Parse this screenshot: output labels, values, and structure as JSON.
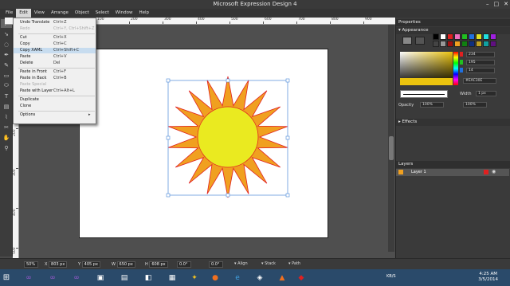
{
  "window": {
    "title": "Microsoft Expression Design 4"
  },
  "menubar": [
    "File",
    "Edit",
    "View",
    "Arrange",
    "Object",
    "Select",
    "Window",
    "Help"
  ],
  "edit_menu": [
    {
      "label": "Undo Translate",
      "shortcut": "Ctrl+Z",
      "disabled": false
    },
    {
      "label": "Redo",
      "shortcut": "Ctrl+Y, Ctrl+Shift+Z",
      "disabled": true
    },
    {
      "label": "Cut",
      "shortcut": "Ctrl+X",
      "disabled": false
    },
    {
      "label": "Copy",
      "shortcut": "Ctrl+C",
      "disabled": false
    },
    {
      "label": "Copy XAML",
      "shortcut": "Ctrl+Shift+C",
      "disabled": false,
      "highlighted": true
    },
    {
      "label": "Paste",
      "shortcut": "Ctrl+V",
      "disabled": false
    },
    {
      "label": "Delete",
      "shortcut": "Del",
      "disabled": false
    },
    {
      "label": "Paste in Front",
      "shortcut": "Ctrl+F",
      "disabled": false
    },
    {
      "label": "Paste in Back",
      "shortcut": "Ctrl+B",
      "disabled": false
    },
    {
      "label": "Paste Special",
      "shortcut": "",
      "disabled": true
    },
    {
      "label": "Paste with Layer",
      "shortcut": "Ctrl+Alt+L",
      "disabled": false
    },
    {
      "label": "Duplicate",
      "shortcut": "",
      "disabled": false
    },
    {
      "label": "Clone",
      "shortcut": "",
      "disabled": false
    },
    {
      "label": "Options",
      "shortcut": "",
      "disabled": false
    }
  ],
  "ruler": {
    "h_labels": [
      "-100",
      "0",
      "100",
      "200",
      "300",
      "400",
      "500",
      "600",
      "700",
      "800",
      "900",
      "1000"
    ],
    "v_labels": [
      "0",
      "100",
      "200",
      "300",
      "400",
      "500"
    ]
  },
  "bottombar": {
    "zoom": "50%",
    "x_label": "X",
    "x_value": "803 px",
    "y_label": "Y",
    "y_value": "405 px",
    "w_label": "W",
    "w_value": "650 px",
    "h_label": "H",
    "h_value": "608 px",
    "rot_value": "0.0°",
    "skew_value": "0.0°",
    "align": "Align",
    "stack": "Stack",
    "path": "Path"
  },
  "properties": {
    "title": "Properties",
    "appearance": "Appearance",
    "r": "234",
    "g": "195",
    "b": "14",
    "hex": "#EAC30E",
    "width_label": "Width",
    "width_value": "1 px",
    "opacity_label": "Opacity",
    "opacity_value": "100%",
    "fill_opacity": "100%",
    "effects": "Effects"
  },
  "layers": {
    "title": "Layers",
    "layer1": "Layer 1"
  },
  "clock": {
    "time": "4:25 AM",
    "date": "3/5/2014"
  },
  "tray": {
    "net": "KB/S"
  },
  "colors": {
    "sun_fill": "#EAC30E",
    "sun_stroke": "#e02020",
    "rays": "#f0a020"
  }
}
